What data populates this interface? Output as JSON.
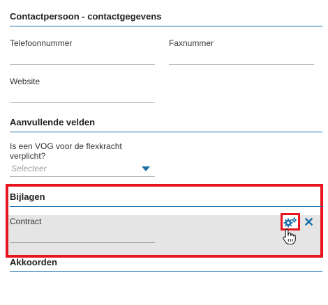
{
  "contact": {
    "title": "Contactpersoon - contactgegevens",
    "phone_label": "Telefoonnummer",
    "fax_label": "Faxnummer",
    "website_label": "Website"
  },
  "extra": {
    "title": "Aanvullende velden",
    "vog_label": "Is een VOG voor de flexkracht verplicht?",
    "vog_placeholder": "Selecteer"
  },
  "attachments": {
    "title": "Bijlagen",
    "contract_label": "Contract"
  },
  "agreements": {
    "title": "Akkoorden"
  },
  "colors": {
    "accent": "#1a6fa8",
    "highlight": "#e8141e"
  }
}
